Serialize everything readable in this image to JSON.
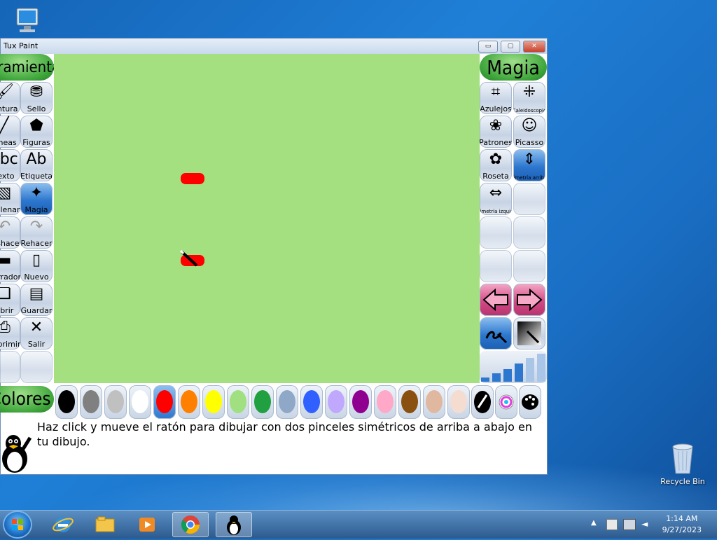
{
  "desktop": {
    "computer_icon": "computer-icon",
    "recycle_bin_label": "Recycle Bin"
  },
  "window": {
    "title": "Tux Paint",
    "minimize": "▭",
    "maximize": "▢",
    "close": "✕"
  },
  "left_panel": {
    "header": "Herramientas",
    "tools": [
      {
        "label": "Pintura",
        "icon": "brush-icon"
      },
      {
        "label": "Sello",
        "icon": "stamp-icon"
      },
      {
        "label": "Líneas",
        "icon": "lines-icon"
      },
      {
        "label": "Figuras",
        "icon": "shapes-icon"
      },
      {
        "label": "Texto",
        "icon": "text-icon"
      },
      {
        "label": "Etiqueta",
        "icon": "label-icon"
      },
      {
        "label": "Rellenar",
        "icon": "fill-icon"
      },
      {
        "label": "Magia",
        "icon": "magic-icon"
      },
      {
        "label": "Deshacer",
        "icon": "undo-icon"
      },
      {
        "label": "Rehacer",
        "icon": "redo-icon"
      },
      {
        "label": "Borrador",
        "icon": "eraser-icon"
      },
      {
        "label": "Nuevo",
        "icon": "new-icon"
      },
      {
        "label": "Abrir",
        "icon": "open-icon"
      },
      {
        "label": "Guardar",
        "icon": "save-icon"
      },
      {
        "label": "Imprimir",
        "icon": "print-icon"
      },
      {
        "label": "Salir",
        "icon": "quit-icon"
      }
    ]
  },
  "right_panel": {
    "header": "Magia",
    "tools": [
      {
        "label": "Azulejos",
        "icon": "tiles-icon"
      },
      {
        "label": "Caleidoscopio",
        "icon": "kaleidoscope-icon"
      },
      {
        "label": "Patrones",
        "icon": "patterns-icon"
      },
      {
        "label": "Picasso",
        "icon": "picasso-icon"
      },
      {
        "label": "Roseta",
        "icon": "rosette-icon"
      },
      {
        "label": "Simetría arriba/abajo",
        "icon": "symmetry-updown-icon"
      },
      {
        "label": "Simetría izquierda/derecha",
        "icon": "symmetry-leftright-icon"
      }
    ],
    "prev": "previous-arrow-icon",
    "next": "next-arrow-icon"
  },
  "colors": {
    "header": "Colores",
    "swatches": [
      "#000000",
      "#808080",
      "#c0c0c0",
      "#ffffff",
      "#ff0000",
      "#ff8000",
      "#ffff00",
      "#a0e080",
      "#20a040",
      "#8fa8c8",
      "#3060ff",
      "#c0a8ff",
      "#900090",
      "#ffa8c8",
      "#8a5010",
      "#e0b8a0",
      "#f5dcd0"
    ],
    "selected_index": 4
  },
  "message": "Haz click y mueve el ratón para dibujar con dos pinceles simétricos de arriba a abajo en tu dibujo.",
  "taskbar": {
    "time": "1:14 AM",
    "date": "9/27/2023"
  }
}
